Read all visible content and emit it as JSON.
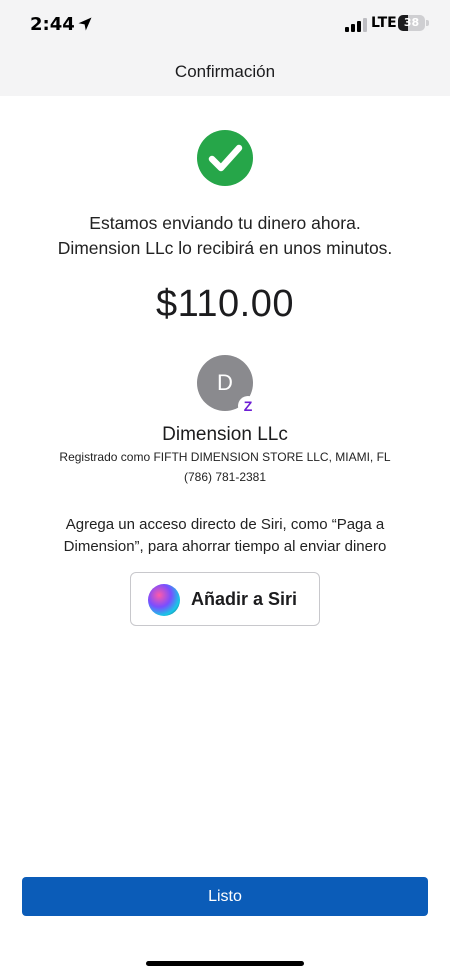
{
  "status_bar": {
    "time": "2:44",
    "network": "LTE",
    "battery_percent": "38",
    "battery_level": 0.38,
    "location_icon": "location-arrow-icon",
    "signal_icon": "cellular-signal-icon"
  },
  "header": {
    "title": "Confirmación"
  },
  "confirmation": {
    "icon": "check-circle-icon",
    "icon_color": "#26a649",
    "message_line1": "Estamos enviando tu dinero ahora.",
    "message_line2": "Dimension LLc lo recibirá en unos minutos.",
    "amount": "$110.00"
  },
  "recipient": {
    "avatar_initial": "D",
    "badge": "Z",
    "badge_color": "#6d1ed4",
    "name": "Dimension LLc",
    "registered_as": "Registrado como FIFTH DIMENSION STORE LLC, MIAMI, FL",
    "phone": "(786) 781-2381"
  },
  "siri": {
    "prompt_line1": "Agrega un acceso directo de Siri, como “Paga a",
    "prompt_line2": "Dimension”, para ahorrar tiempo al enviar dinero",
    "button_label": "Añadir a Siri",
    "icon": "siri-icon"
  },
  "footer": {
    "done_label": "Listo",
    "done_color": "#0b5cb8"
  }
}
